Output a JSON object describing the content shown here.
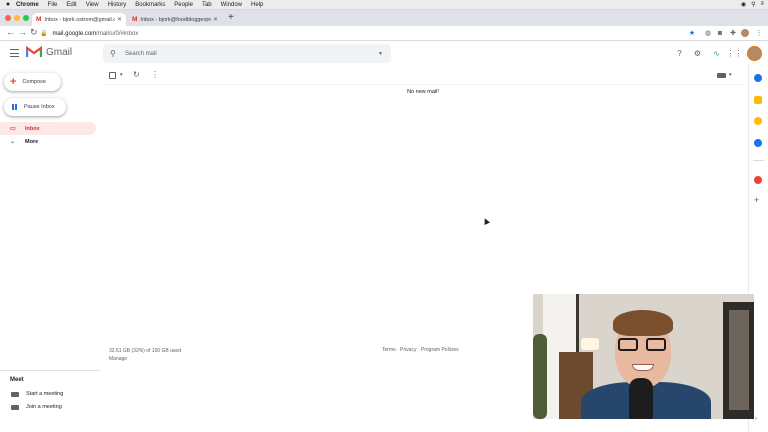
{
  "menubar": {
    "app": "Chrome",
    "items": [
      "File",
      "Edit",
      "View",
      "History",
      "Bookmarks",
      "People",
      "Tab",
      "Window",
      "Help"
    ]
  },
  "tabs": [
    {
      "title": "Inbox - bjork.ostrom@gmail.co"
    },
    {
      "title": "Inbox - bjork@foodbloggerpro"
    }
  ],
  "address": {
    "domain": "mail.google.com",
    "path": "/mail/u/0/#inbox"
  },
  "gmail": {
    "logo_text": "Gmail",
    "search_placeholder": "Search mail"
  },
  "nav": {
    "compose": "Compose",
    "pause_inbox": "Pause Inbox",
    "items": [
      {
        "label": "Inbox"
      },
      {
        "label": "More"
      }
    ]
  },
  "meet": {
    "title": "Meet",
    "items": [
      {
        "label": "Start a meeting"
      },
      {
        "label": "Join a meeting"
      }
    ]
  },
  "main": {
    "empty_message": "No new mail!"
  },
  "footer": {
    "storage": "32.61 GB (32%) of 100 GB used",
    "manage": "Manage",
    "links": "Terms · Privacy · Program Policies"
  },
  "colors": {
    "gmail_red": "#d93025",
    "inbox_highlight": "#fce8e6",
    "accent_blue": "#1a73e8"
  }
}
